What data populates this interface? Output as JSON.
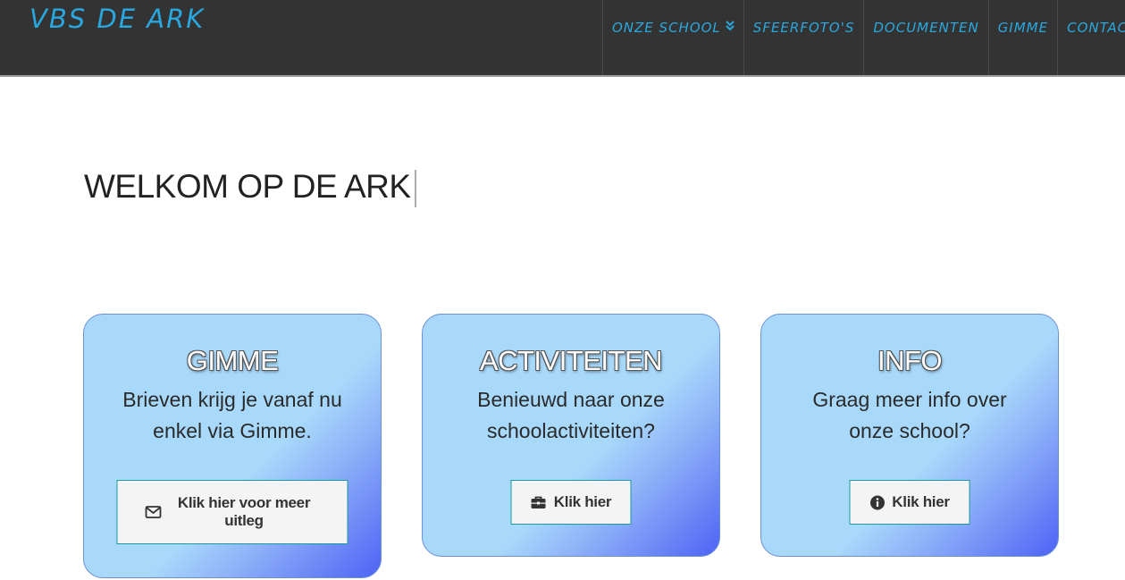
{
  "navbar": {
    "brand": "VBS DE ARK",
    "items": [
      {
        "label": "ONZE SCHOOL",
        "has_dropdown": true
      },
      {
        "label": "SFEERFOTO'S"
      },
      {
        "label": "DOCUMENTEN"
      },
      {
        "label": "GIMME"
      },
      {
        "label": "CONTACT"
      }
    ],
    "accent": "#29a8e0",
    "background": "#333333"
  },
  "main": {
    "welcome": "WELKOM OP DE ARK"
  },
  "cards": [
    {
      "title": "GIMME",
      "text": "Brieven krijg je vanaf nu enkel via Gimme.",
      "button": "Klik hier voor meer uitleg",
      "icon": "envelope-icon"
    },
    {
      "title": "ACTIVITEITEN",
      "text": "Benieuwd naar onze schoolactiviteiten?",
      "button": "Klik hier",
      "icon": "briefcase-icon"
    },
    {
      "title": "INFO",
      "text": "Graag meer info over onze school?",
      "button": "Klik hier",
      "icon": "info-circle-icon"
    }
  ],
  "colors": {
    "card_light": "#a8d9fb",
    "card_dark": "#4d63f5",
    "button_border": "#1a9a9a"
  }
}
